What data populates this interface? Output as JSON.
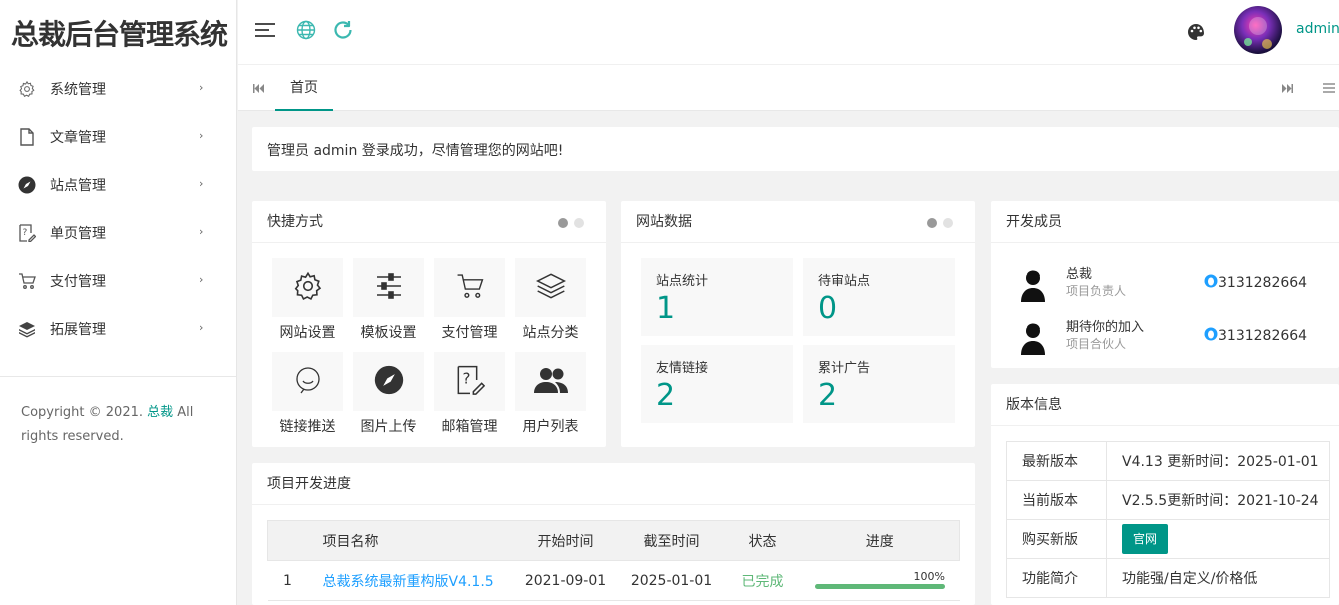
{
  "app": {
    "title": "总裁后台管理系统",
    "username": "admin"
  },
  "sidebar": {
    "items": [
      {
        "label": "系统管理",
        "icon": "gear-icon"
      },
      {
        "label": "文章管理",
        "icon": "document-icon"
      },
      {
        "label": "站点管理",
        "icon": "compass-icon"
      },
      {
        "label": "单页管理",
        "icon": "help-page-icon"
      },
      {
        "label": "支付管理",
        "icon": "cart-icon"
      },
      {
        "label": "拓展管理",
        "icon": "layers-icon"
      }
    ],
    "chevron": "›"
  },
  "footer": {
    "prefix": "Copyright © 2021. ",
    "link": "总裁",
    "suffix": " All rights reserved."
  },
  "tabs": {
    "home": "首页"
  },
  "notice": "管理员 admin 登录成功，尽情管理您的网站吧!",
  "shortcuts": {
    "title": "快捷方式",
    "items": [
      {
        "label": "网站设置",
        "icon": "gear-icon"
      },
      {
        "label": "模板设置",
        "icon": "sliders-icon"
      },
      {
        "label": "支付管理",
        "icon": "cart-icon"
      },
      {
        "label": "站点分类",
        "icon": "layers-icon"
      },
      {
        "label": "链接推送",
        "icon": "chat-bubble-icon"
      },
      {
        "label": "图片上传",
        "icon": "compass-icon"
      },
      {
        "label": "邮箱管理",
        "icon": "help-edit-icon"
      },
      {
        "label": "用户列表",
        "icon": "users-icon"
      }
    ]
  },
  "site_data": {
    "title": "网站数据",
    "stats": [
      {
        "label": "站点统计",
        "value": "1"
      },
      {
        "label": "待审站点",
        "value": "0"
      },
      {
        "label": "友情链接",
        "value": "2"
      },
      {
        "label": "累计广告",
        "value": "2"
      }
    ]
  },
  "team": {
    "title": "开发成员",
    "members": [
      {
        "name": "总裁",
        "role": "项目负责人",
        "qq": "3131282664"
      },
      {
        "name": "期待你的加入",
        "role": "项目合伙人",
        "qq": "3131282664"
      }
    ]
  },
  "version": {
    "title": "版本信息",
    "rows": [
      {
        "key": "最新版本",
        "value": "V4.13 更新时间：2025-01-01"
      },
      {
        "key": "当前版本",
        "value": "V2.5.5更新时间：2021-10-24"
      },
      {
        "key": "购买新版",
        "value": "官网"
      },
      {
        "key": "功能简介",
        "value": "功能强/自定义/价格低"
      }
    ]
  },
  "progress": {
    "title": "项目开发进度",
    "headers": [
      "",
      "项目名称",
      "开始时间",
      "截至时间",
      "状态",
      "进度"
    ],
    "rows": [
      {
        "index": "1",
        "name": "总裁系统最新重构版V4.1.5",
        "start": "2021-09-01",
        "end": "2025-01-01",
        "status": "已完成",
        "percent": 100,
        "percent_label": "100%"
      }
    ]
  },
  "colors": {
    "accent": "#009688",
    "link": "#1e9fff",
    "done": "#5fb878"
  }
}
